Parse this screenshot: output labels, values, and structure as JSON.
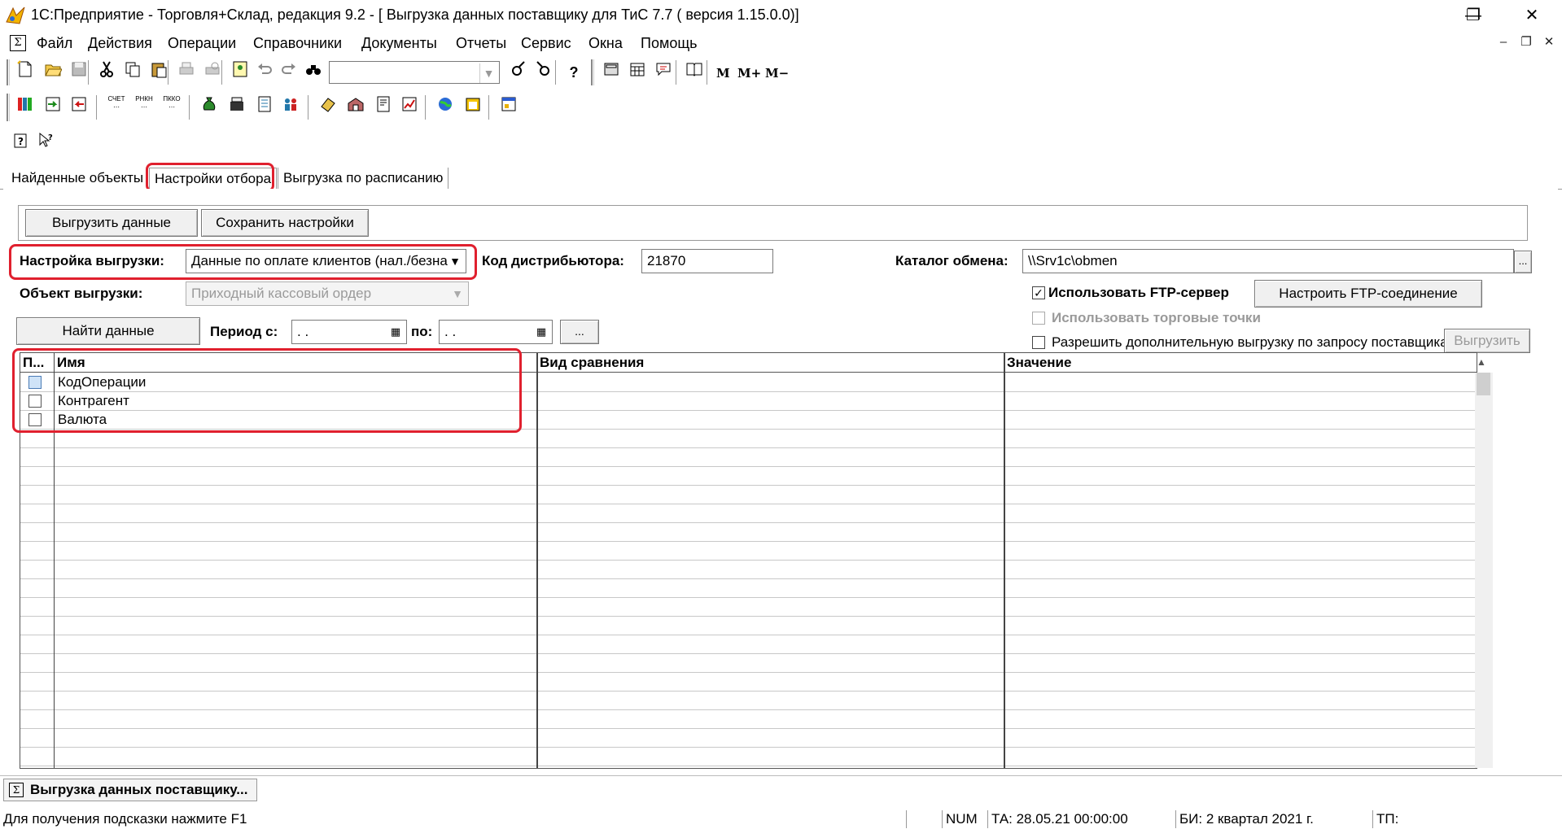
{
  "window": {
    "title": "1С:Предприятие - Торговля+Склад, редакция 9.2 - [ Выгрузка данных поставщику для ТиС 7.7 ( версия 1.15.0.0)]",
    "minimize": "—",
    "restore": "❐",
    "close": "✕"
  },
  "menu": {
    "system_icon": "Σ",
    "items": [
      "Файл",
      "Действия",
      "Операции",
      "Справочники",
      "Документы",
      "Отчеты",
      "Сервис",
      "Окна",
      "Помощь"
    ],
    "mdi_minimize": "–",
    "mdi_restore": "❐",
    "mdi_close": "✕"
  },
  "toolbar": {
    "search_combo_value": "",
    "m_label": "M",
    "m_plus_label": "M+",
    "m_minus_label": "M−"
  },
  "tabs": [
    {
      "label": "Найденные объекты"
    },
    {
      "label": "Настройки отбора"
    },
    {
      "label": "Выгрузка по расписанию"
    }
  ],
  "form": {
    "export_button": "Выгрузить данные",
    "save_settings_button": "Сохранить настройки",
    "export_setting_label": "Настройка выгрузки:",
    "export_setting_value": "Данные по оплате клиентов (нал./безна",
    "distributor_code_label": "Код дистрибьютора:",
    "distributor_code_value": "21870",
    "exchange_dir_label": "Каталог обмена:",
    "exchange_dir_value": "\\\\Srv1c\\obmen",
    "browse_button": "...",
    "export_object_label": "Объект выгрузки:",
    "export_object_value": "Приходный кассовый ордер",
    "use_ftp_label": "Использовать FTP-сервер",
    "use_ftp_checked": true,
    "configure_ftp_button": "Настроить FTP-соединение",
    "use_outlets_label": "Использовать торговые точки",
    "allow_extra_export_label": "Разрешить дополнительную выгрузку по запросу поставщика",
    "export_button_disabled": "Выгрузить",
    "find_data_button": "Найти данные",
    "period_from_label": "Период с:",
    "period_from_value": " .  .",
    "period_to_label": "по:",
    "period_to_value": " .  .",
    "period_more_button": "..."
  },
  "grid": {
    "columns": [
      "П...",
      "Имя",
      "Вид сравнения",
      "Значение"
    ],
    "rows": [
      {
        "name": "КодОперации",
        "checked": false,
        "selected": true
      },
      {
        "name": "Контрагент",
        "checked": false,
        "selected": false
      },
      {
        "name": "Валюта",
        "checked": false,
        "selected": false
      }
    ]
  },
  "taskbar": {
    "window_icon": "Σ",
    "window_label": "Выгрузка данных поставщику..."
  },
  "status": {
    "hint": "Для получения подсказки нажмите F1",
    "num": "NUM",
    "ta": "ТА: 28.05.21  00:00:00",
    "bi": "БИ: 2 квартал 2021 г.",
    "tp": "ТП:"
  },
  "colors": {
    "highlight_outline": "#e0202e",
    "selected_cell": "#cfe3f7"
  }
}
